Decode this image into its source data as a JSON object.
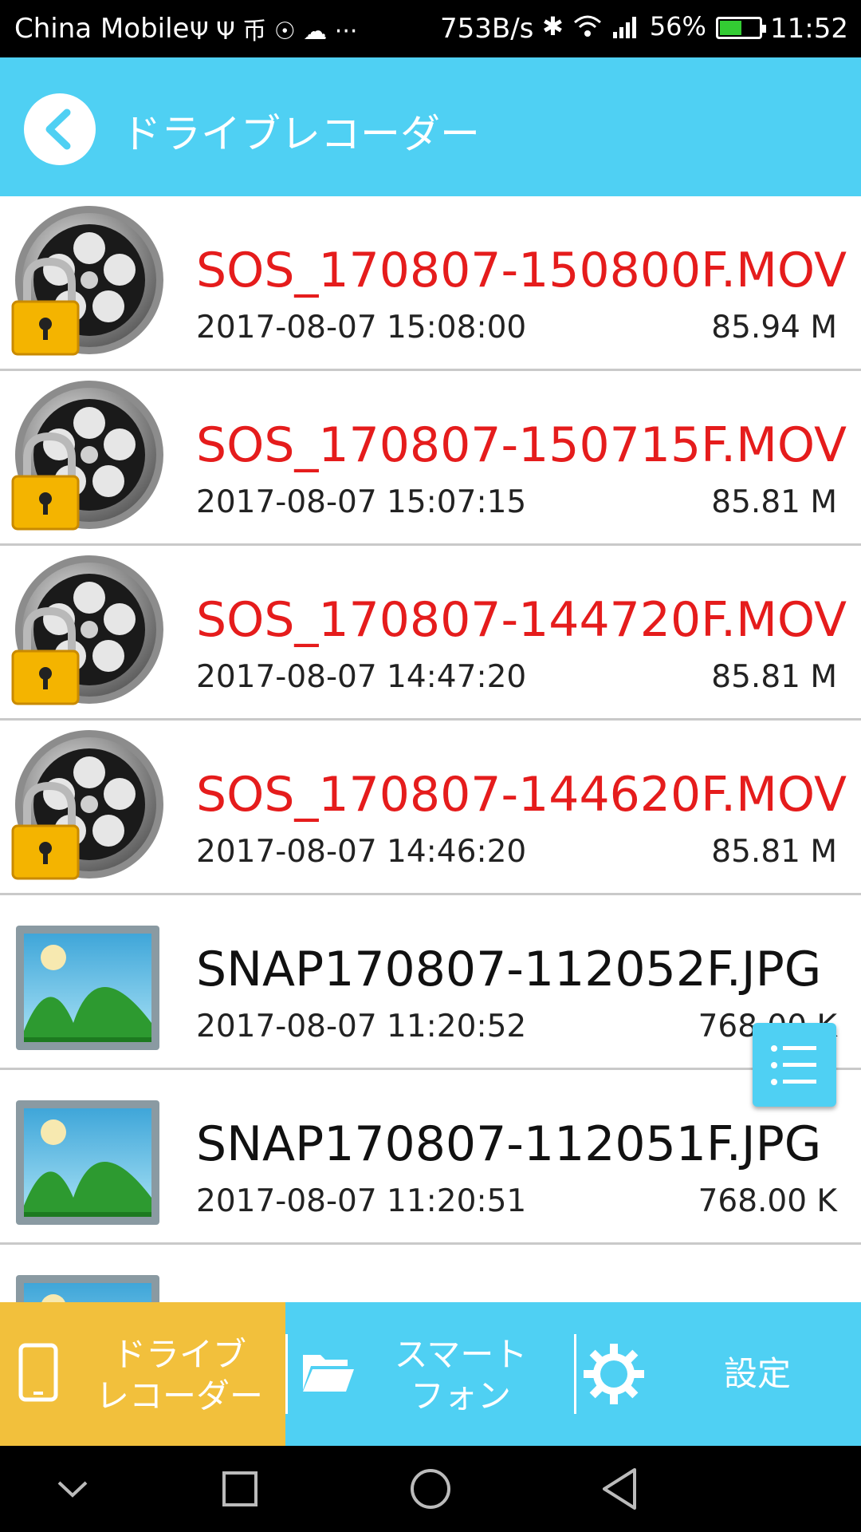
{
  "status_bar": {
    "carrier": "China Mobile",
    "left_icons": "Ψ Ψ 币 ☉ ☁ ···",
    "net_speed": "753B/s",
    "battery_percent": "56%",
    "battery_level": 0.56,
    "time": "11:52"
  },
  "app_bar": {
    "title": "ドライブレコーダー",
    "back_icon": "chevron-left-icon"
  },
  "files": [
    {
      "name": "SOS_170807-150800F.MOV",
      "date": "2017-08-07 15:08:00",
      "size": "85.94 M",
      "type": "sos"
    },
    {
      "name": "SOS_170807-150715F.MOV",
      "date": "2017-08-07 15:07:15",
      "size": "85.81 M",
      "type": "sos"
    },
    {
      "name": "SOS_170807-144720F.MOV",
      "date": "2017-08-07 14:47:20",
      "size": "85.81 M",
      "type": "sos"
    },
    {
      "name": "SOS_170807-144620F.MOV",
      "date": "2017-08-07 14:46:20",
      "size": "85.81 M",
      "type": "sos"
    },
    {
      "name": "SNAP170807-112052F.JPG",
      "date": "2017-08-07 11:20:52",
      "size": "768.00 K",
      "type": "snap"
    },
    {
      "name": "SNAP170807-112051F.JPG",
      "date": "2017-08-07 11:20:51",
      "size": "768.00 K",
      "type": "snap"
    },
    {
      "name": "",
      "date": "",
      "size": "",
      "type": "snap"
    }
  ],
  "tabs": [
    {
      "label_line1": "ドライブ",
      "label_line2": "レコーダー",
      "icon": "phone-icon"
    },
    {
      "label_line1": "スマート",
      "label_line2": "フォン",
      "icon": "folder-icon"
    },
    {
      "label": "設定",
      "icon": "gear-icon"
    }
  ],
  "colors": {
    "accent": "#4fd0f3",
    "active_tab": "#f2c03c",
    "sos_text": "#e51c1c"
  }
}
